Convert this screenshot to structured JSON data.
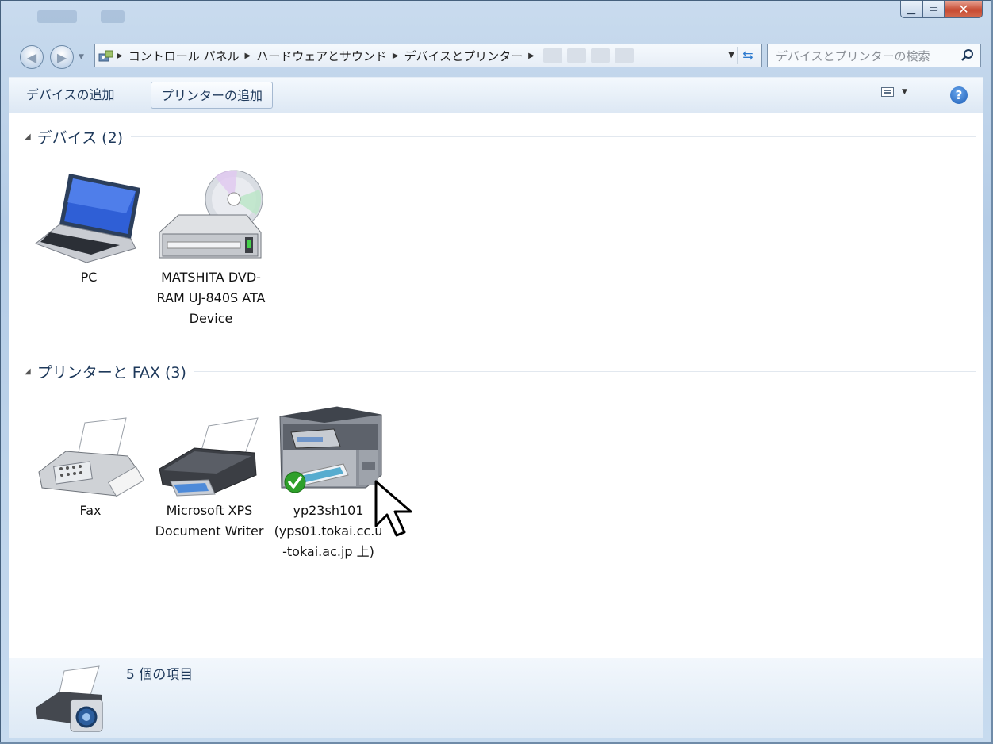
{
  "nav": {
    "breadcrumbs": [
      "コントロール パネル",
      "ハードウェアとサウンド",
      "デバイスとプリンター"
    ],
    "search_placeholder": "デバイスとプリンターの検索"
  },
  "toolbar": {
    "add_device": "デバイスの追加",
    "add_printer": "プリンターの追加"
  },
  "groups": [
    {
      "header": "デバイス (2)",
      "items": [
        {
          "icon": "laptop-icon",
          "label": "PC"
        },
        {
          "icon": "dvd-drive-icon",
          "label": "MATSHITA DVD-RAM UJ-840S ATA Device"
        }
      ]
    },
    {
      "header": "プリンターと FAX (3)",
      "items": [
        {
          "icon": "fax-icon",
          "label": "Fax"
        },
        {
          "icon": "printer-icon",
          "label": "Microsoft XPS Document Writer"
        },
        {
          "icon": "multifunction-printer-icon",
          "label": "yp23sh101 (yps01.tokai.cc.u-tokai.ac.jp 上)",
          "default": true
        }
      ]
    }
  ],
  "details": {
    "count_text": "5 個の項目"
  },
  "colors": {
    "accent": "#1e395b",
    "close": "#c64a32",
    "default_check": "#2ea02a"
  }
}
